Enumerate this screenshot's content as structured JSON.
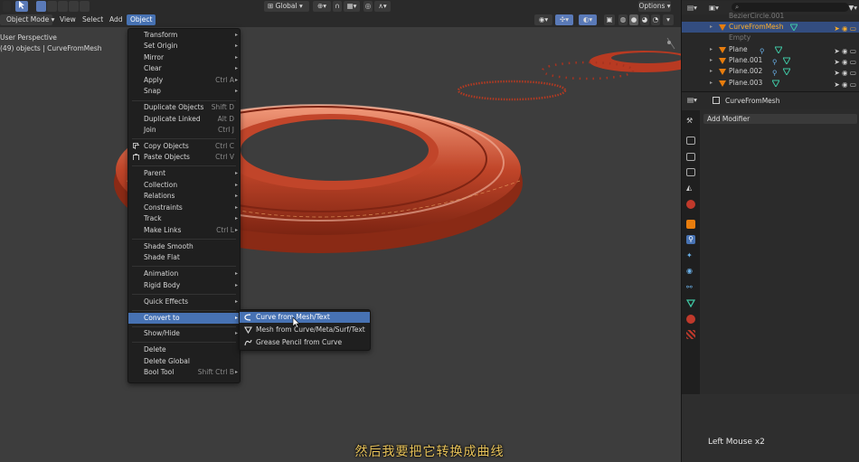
{
  "header": {
    "mode": "Object Mode",
    "menus": [
      "View",
      "Select",
      "Add",
      "Object"
    ],
    "orientation": "Global",
    "options": "Options"
  },
  "viewport": {
    "perspective": "User Perspective",
    "info": "(49) objects | CurveFromMesh"
  },
  "object_menu": {
    "items": [
      {
        "label": "Transform",
        "shortcut": ""
      },
      {
        "label": "Set Origin",
        "shortcut": ""
      },
      {
        "label": "Mirror",
        "shortcut": ""
      },
      {
        "label": "Clear",
        "shortcut": ""
      },
      {
        "label": "Apply",
        "shortcut": "Ctrl A"
      },
      {
        "label": "Snap",
        "shortcut": ""
      },
      {
        "label": "Duplicate Objects",
        "shortcut": "Shift D"
      },
      {
        "label": "Duplicate Linked",
        "shortcut": "Alt D"
      },
      {
        "label": "Join",
        "shortcut": "Ctrl J"
      },
      {
        "label": "Copy Objects",
        "shortcut": "Ctrl C"
      },
      {
        "label": "Paste Objects",
        "shortcut": "Ctrl V"
      },
      {
        "label": "Parent",
        "shortcut": ""
      },
      {
        "label": "Collection",
        "shortcut": ""
      },
      {
        "label": "Relations",
        "shortcut": ""
      },
      {
        "label": "Constraints",
        "shortcut": ""
      },
      {
        "label": "Track",
        "shortcut": ""
      },
      {
        "label": "Make Links",
        "shortcut": "Ctrl L"
      },
      {
        "label": "Shade Smooth",
        "shortcut": ""
      },
      {
        "label": "Shade Flat",
        "shortcut": ""
      },
      {
        "label": "Animation",
        "shortcut": ""
      },
      {
        "label": "Rigid Body",
        "shortcut": ""
      },
      {
        "label": "Quick Effects",
        "shortcut": ""
      },
      {
        "label": "Convert to",
        "shortcut": ""
      },
      {
        "label": "Show/Hide",
        "shortcut": ""
      },
      {
        "label": "Delete",
        "shortcut": ""
      },
      {
        "label": "Delete Global",
        "shortcut": ""
      },
      {
        "label": "Bool Tool",
        "shortcut": "Shift Ctrl B"
      }
    ]
  },
  "convert_submenu": {
    "items": [
      {
        "label": "Curve from Mesh/Text"
      },
      {
        "label": "Mesh from Curve/Meta/Surf/Text"
      },
      {
        "label": "Grease Pencil from Curve"
      }
    ]
  },
  "outliner": {
    "rows": [
      {
        "name": "BezierCircle.001"
      },
      {
        "name": "CurveFromMesh"
      },
      {
        "name": "Empty"
      },
      {
        "name": "Plane"
      },
      {
        "name": "Plane.001"
      },
      {
        "name": "Plane.002"
      },
      {
        "name": "Plane.003"
      }
    ]
  },
  "properties": {
    "object_name": "CurveFromMesh",
    "add_modifier": "Add Modifier"
  },
  "status": {
    "key_hint": "Left Mouse x2"
  },
  "subtitle": "然后我要把它转换成曲线",
  "colors": {
    "accent": "#4772b3",
    "selected_row": "#334d80",
    "active_object_text": "#ffaf29",
    "mesh_icon": "#e87d0d",
    "modifier_icon": "#3fc6a3",
    "torus": "#b83a22",
    "subtitle": "#e8c35a"
  }
}
